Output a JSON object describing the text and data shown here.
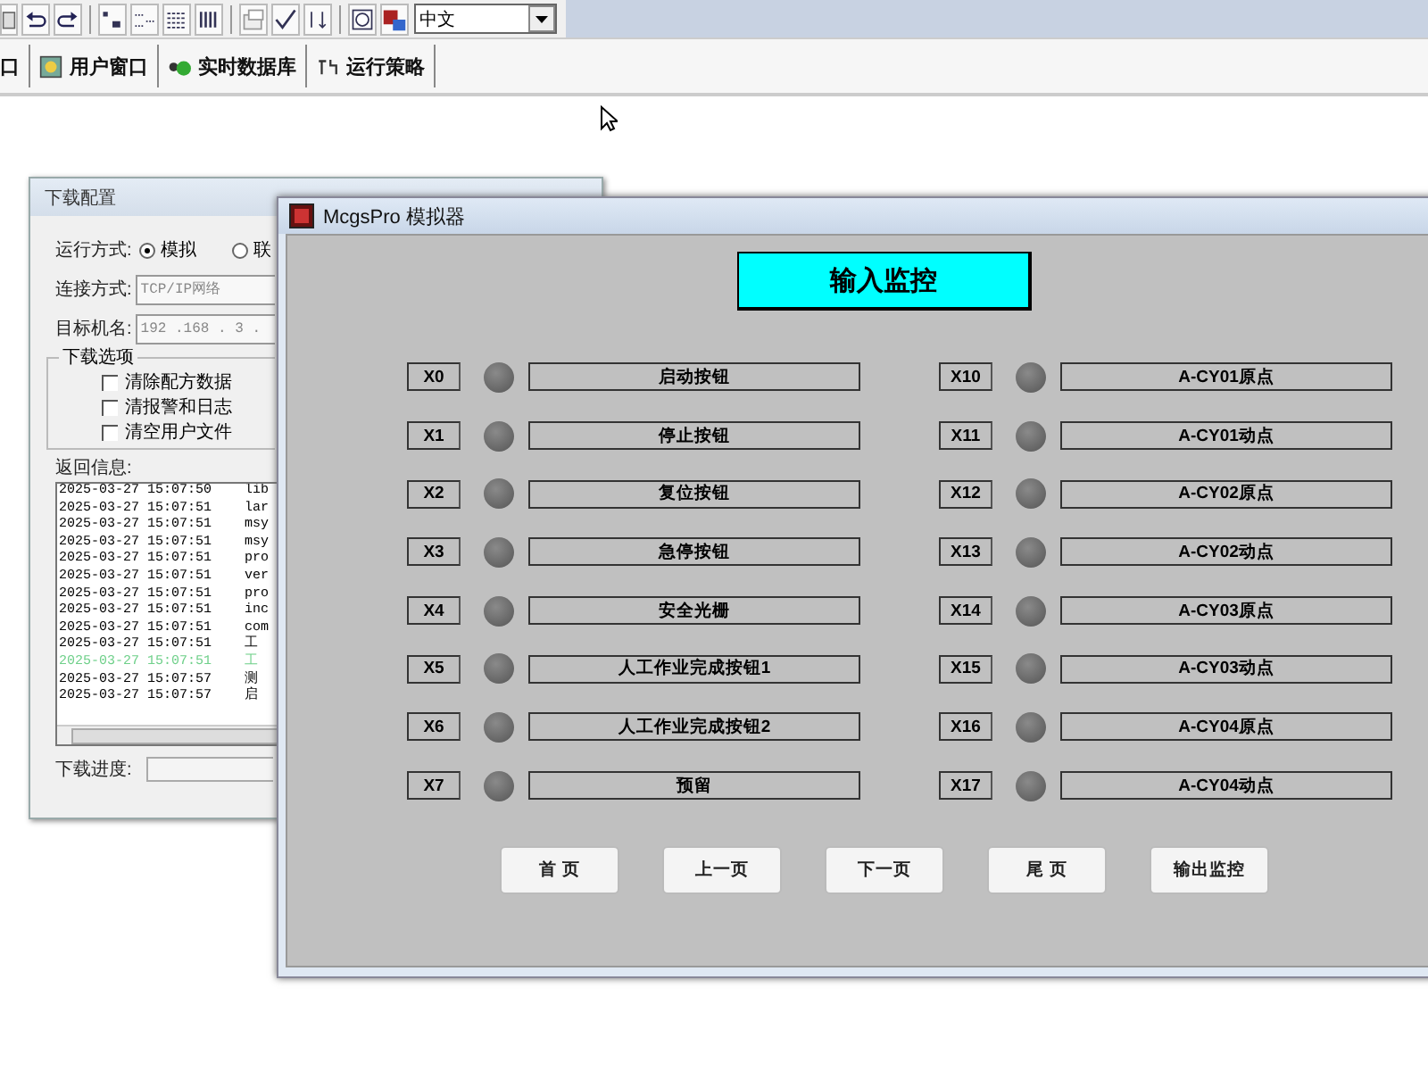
{
  "toolbar": {
    "language": "中文"
  },
  "tabs": [
    {
      "label": "口",
      "selected": false
    },
    {
      "label": "用户窗口",
      "selected": false
    },
    {
      "label": "实时数据库",
      "selected": false
    },
    {
      "label": "运行策略",
      "selected": false
    }
  ],
  "download_dialog": {
    "title": "下载配置",
    "run_mode_label": "运行方式:",
    "run_modes": [
      {
        "label": "模拟",
        "selected": true
      },
      {
        "label": "联",
        "selected": false
      }
    ],
    "connection_label": "连接方式:",
    "connection": "TCP/IP网络",
    "target_label": "目标机名:",
    "target": "192 .168 . 3 .",
    "options_title": "下载选项",
    "options": [
      {
        "label": "清除配方数据",
        "checked": false
      },
      {
        "label": "清报警和日志",
        "checked": false
      },
      {
        "label": "清空用户文件",
        "checked": false
      }
    ],
    "log_label": "返回信息:",
    "log": [
      {
        "time": "2025-03-27 15:07:50",
        "message": "lib",
        "color": "#000000"
      },
      {
        "time": "2025-03-27 15:07:51",
        "message": "lar",
        "color": "#000000"
      },
      {
        "time": "2025-03-27 15:07:51",
        "message": "msy",
        "color": "#000000"
      },
      {
        "time": "2025-03-27 15:07:51",
        "message": "msy",
        "color": "#000000"
      },
      {
        "time": "2025-03-27 15:07:51",
        "message": "pro",
        "color": "#000000"
      },
      {
        "time": "2025-03-27 15:07:51",
        "message": "ver",
        "color": "#000000"
      },
      {
        "time": "2025-03-27 15:07:51",
        "message": "pro",
        "color": "#000000"
      },
      {
        "time": "2025-03-27 15:07:51",
        "message": "inc",
        "color": "#000000"
      },
      {
        "time": "2025-03-27 15:07:51",
        "message": "com",
        "color": "#000000"
      },
      {
        "time": "2025-03-27 15:07:51",
        "message": "工",
        "color": "#000000"
      },
      {
        "time": "2025-03-27 15:07:51",
        "message": "工",
        "color": "#6fd08a"
      },
      {
        "time": "2025-03-27 15:07:57",
        "message": "测",
        "color": "#000000"
      },
      {
        "time": "2025-03-27 15:07:57",
        "message": "启",
        "color": "#000000"
      }
    ],
    "progress_label": "下载进度:",
    "progress": {
      "level": 0
    }
  },
  "simulator": {
    "title": "McgsPro 模拟器",
    "heading": "输入监控",
    "inputs": [
      {
        "address": "X0",
        "name": "启动按钮",
        "on": false
      },
      {
        "address": "X1",
        "name": "停止按钮",
        "on": false
      },
      {
        "address": "X2",
        "name": "复位按钮",
        "on": false
      },
      {
        "address": "X3",
        "name": "急停按钮",
        "on": false
      },
      {
        "address": "X4",
        "name": "安全光栅",
        "on": false
      },
      {
        "address": "X5",
        "name": "人工作业完成按钮1",
        "on": false
      },
      {
        "address": "X6",
        "name": "人工作业完成按钮2",
        "on": false
      },
      {
        "address": "X7",
        "name": "预留",
        "on": false
      },
      {
        "address": "X10",
        "name": "A-CY01原点",
        "on": false
      },
      {
        "address": "X11",
        "name": "A-CY01动点",
        "on": false
      },
      {
        "address": "X12",
        "name": "A-CY02原点",
        "on": false
      },
      {
        "address": "X13",
        "name": "A-CY02动点",
        "on": false
      },
      {
        "address": "X14",
        "name": "A-CY03原点",
        "on": false
      },
      {
        "address": "X15",
        "name": "A-CY03动点",
        "on": false
      },
      {
        "address": "X16",
        "name": "A-CY04原点",
        "on": false
      },
      {
        "address": "X17",
        "name": "A-CY04动点",
        "on": false
      }
    ],
    "buttons": [
      "首 页",
      "上一页",
      "下一页",
      "尾 页",
      "输出监控"
    ]
  }
}
